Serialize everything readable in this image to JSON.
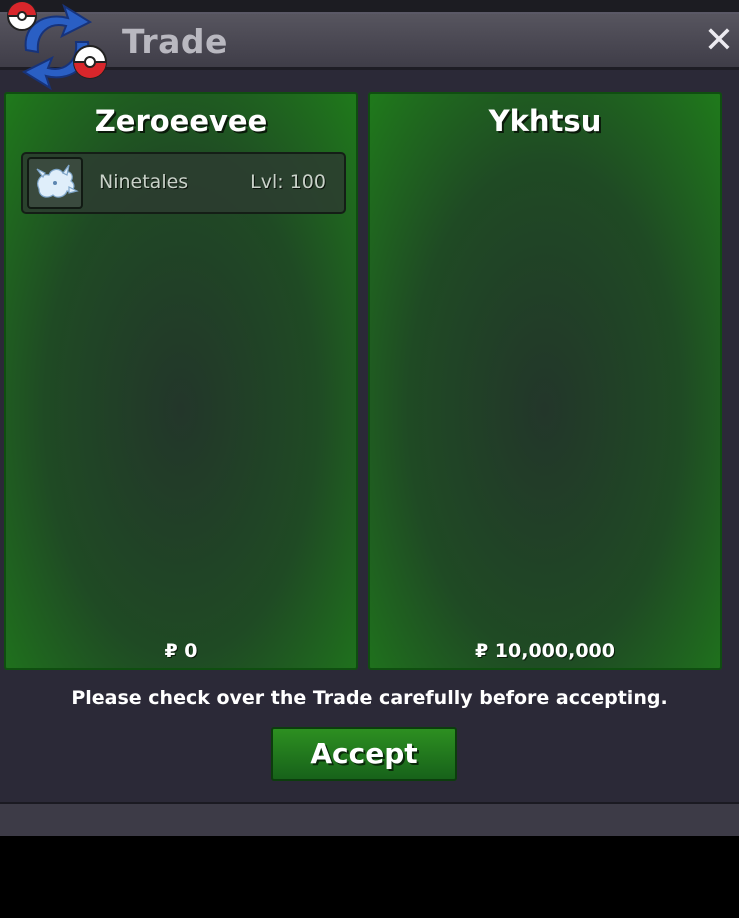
{
  "window": {
    "title": "Trade",
    "close_glyph": "✕",
    "logo_icon": "trade-exchange-icon"
  },
  "panels": [
    {
      "player": "Zeroeevee",
      "items": [
        {
          "icon": "ninetales-sprite-icon",
          "name": "Ninetales",
          "level": "Lvl: 100"
        }
      ],
      "money": "₽ 0"
    },
    {
      "player": "Ykhtsu",
      "items": [],
      "money": "₽ 10,000,000"
    }
  ],
  "footer": {
    "note": "Please check over the Trade carefully before accepting.",
    "accept_label": "Accept"
  },
  "colors": {
    "panel_green": "#1f7a1b",
    "accept_green": "#2d8f21",
    "window_bg": "#2b2937"
  }
}
